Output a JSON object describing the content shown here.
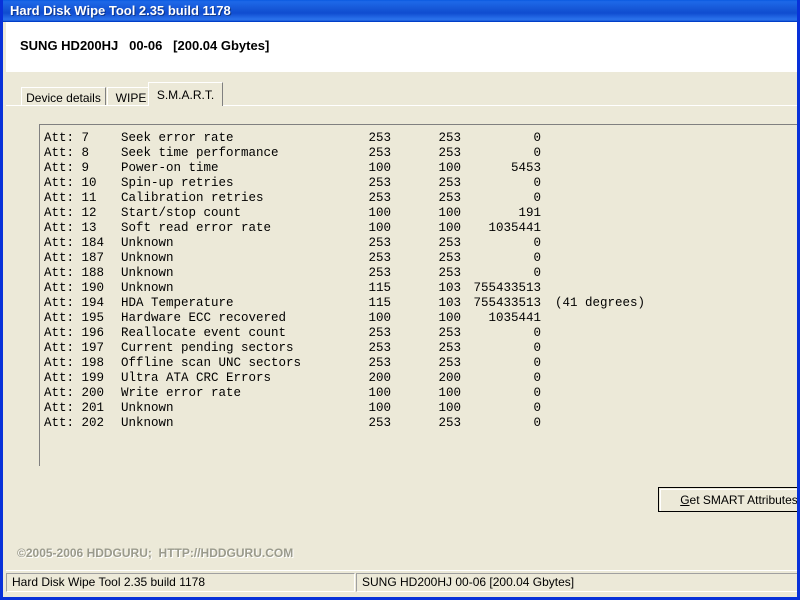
{
  "window": {
    "title": "Hard Disk Wipe Tool 2.35 build 1178"
  },
  "drive_header": {
    "text": "SUNG HD200HJ   00-06   [200.04 Gbytes]"
  },
  "tabs": [
    {
      "label": "Device details",
      "active": false
    },
    {
      "label": "WIPE",
      "active": false
    },
    {
      "label": "S.M.A.R.T.",
      "active": true
    }
  ],
  "smart_table": {
    "rows": [
      {
        "att": "Att: 7",
        "name": "Seek error rate",
        "current": "253",
        "worst": "253",
        "raw": "0",
        "note": ""
      },
      {
        "att": "Att: 8",
        "name": "Seek time performance",
        "current": "253",
        "worst": "253",
        "raw": "0",
        "note": ""
      },
      {
        "att": "Att: 9",
        "name": "Power-on time",
        "current": "100",
        "worst": "100",
        "raw": "5453",
        "note": ""
      },
      {
        "att": "Att: 10",
        "name": "Spin-up retries",
        "current": "253",
        "worst": "253",
        "raw": "0",
        "note": ""
      },
      {
        "att": "Att: 11",
        "name": "Calibration retries",
        "current": "253",
        "worst": "253",
        "raw": "0",
        "note": ""
      },
      {
        "att": "Att: 12",
        "name": "Start/stop count",
        "current": "100",
        "worst": "100",
        "raw": "191",
        "note": ""
      },
      {
        "att": "Att: 13",
        "name": "Soft read error rate",
        "current": "100",
        "worst": "100",
        "raw": "1035441",
        "note": ""
      },
      {
        "att": "Att: 184",
        "name": "Unknown",
        "current": "253",
        "worst": "253",
        "raw": "0",
        "note": ""
      },
      {
        "att": "Att: 187",
        "name": "Unknown",
        "current": "253",
        "worst": "253",
        "raw": "0",
        "note": ""
      },
      {
        "att": "Att: 188",
        "name": "Unknown",
        "current": "253",
        "worst": "253",
        "raw": "0",
        "note": ""
      },
      {
        "att": "Att: 190",
        "name": "Unknown",
        "current": "115",
        "worst": "103",
        "raw": "755433513",
        "note": ""
      },
      {
        "att": "Att: 194",
        "name": "HDA Temperature",
        "current": "115",
        "worst": "103",
        "raw": "755433513",
        "note": "(41 degrees)"
      },
      {
        "att": "Att: 195",
        "name": "Hardware ECC recovered",
        "current": "100",
        "worst": "100",
        "raw": "1035441",
        "note": ""
      },
      {
        "att": "Att: 196",
        "name": "Reallocate event count",
        "current": "253",
        "worst": "253",
        "raw": "0",
        "note": ""
      },
      {
        "att": "Att: 197",
        "name": "Current pending sectors",
        "current": "253",
        "worst": "253",
        "raw": "0",
        "note": ""
      },
      {
        "att": "Att: 198",
        "name": "Offline scan UNC sectors",
        "current": "253",
        "worst": "253",
        "raw": "0",
        "note": ""
      },
      {
        "att": "Att: 199",
        "name": "Ultra ATA CRC Errors",
        "current": "200",
        "worst": "200",
        "raw": "0",
        "note": ""
      },
      {
        "att": "Att: 200",
        "name": "Write error rate",
        "current": "100",
        "worst": "100",
        "raw": "0",
        "note": ""
      },
      {
        "att": "Att: 201",
        "name": "Unknown",
        "current": "100",
        "worst": "100",
        "raw": "0",
        "note": ""
      },
      {
        "att": "Att: 202",
        "name": "Unknown",
        "current": "253",
        "worst": "253",
        "raw": "0",
        "note": ""
      }
    ]
  },
  "buttons": {
    "get_smart_accel": "G",
    "get_smart_rest": "et SMART Attributes"
  },
  "footer": {
    "copyright": "©2005-2006 HDDGURU;  HTTP://HDDGURU.COM"
  },
  "statusbar": {
    "left": "Hard Disk Wipe Tool 2.35 build 1178",
    "right": "SUNG HD200HJ   00-06   [200.04 Gbytes]"
  },
  "colors": {
    "titlebar_blue": "#1658d8",
    "window_border": "#0831d9",
    "face": "#ece9d8",
    "text": "#000000",
    "copyright_text": "#9a9a8c"
  }
}
